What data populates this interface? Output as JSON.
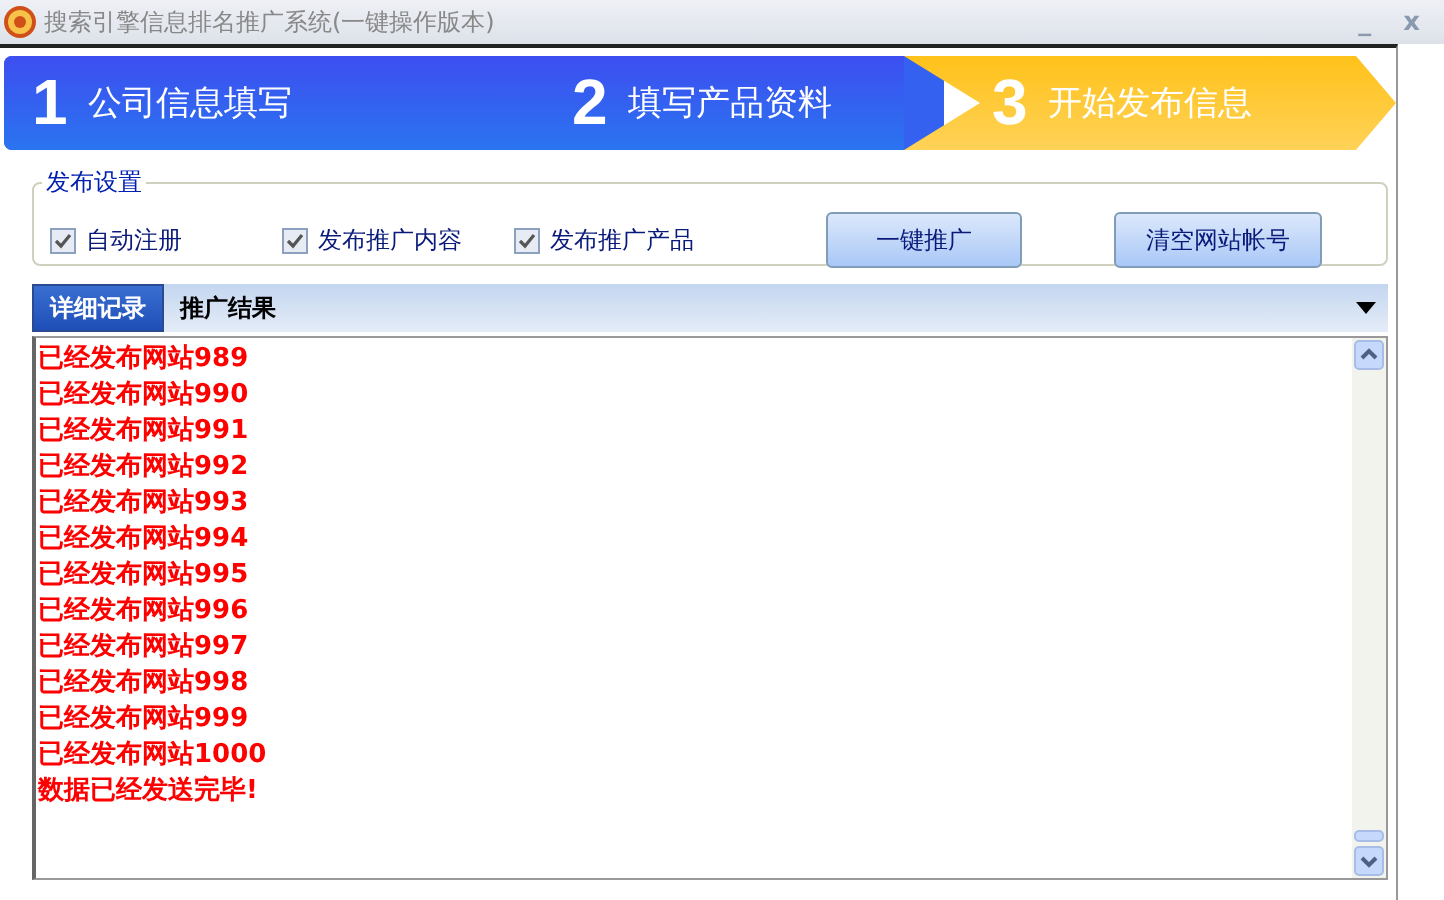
{
  "window": {
    "title": "搜索引擎信息排名推广系统(一键操作版本)",
    "minimize": "_",
    "close": "x"
  },
  "steps": [
    {
      "number": "1",
      "label": "公司信息填写",
      "selected": false
    },
    {
      "number": "2",
      "label": "填写产品资料",
      "selected": false
    },
    {
      "number": "3",
      "label": "开始发布信息",
      "selected": true
    }
  ],
  "settings": {
    "title": "发布设置",
    "options": [
      {
        "label": "自动注册",
        "checked": true
      },
      {
        "label": "发布推广内容",
        "checked": true
      },
      {
        "label": "发布推广产品",
        "checked": true
      }
    ],
    "buttons": [
      "一键推广",
      "清空网站帐号"
    ]
  },
  "tabs": [
    {
      "label": "详细记录",
      "selected": true
    },
    {
      "label": "推广结果",
      "selected": false
    }
  ],
  "log": [
    "已经发布网站989",
    "已经发布网站990",
    "已经发布网站991",
    "已经发布网站992",
    "已经发布网站993",
    "已经发布网站994",
    "已经发布网站995",
    "已经发布网站996",
    "已经发布网站997",
    "已经发布网站998",
    "已经发布网站999",
    "已经发布网站1000",
    "数据已经发送完毕!"
  ]
}
